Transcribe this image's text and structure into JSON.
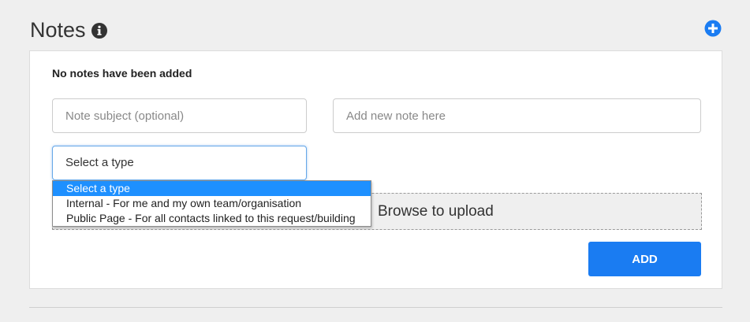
{
  "header": {
    "title": "Notes",
    "info_icon": "info-circle-icon",
    "add_icon": "plus-circle-icon"
  },
  "panel": {
    "empty_message": "No notes have been added",
    "subject_placeholder": "Note subject (optional)",
    "note_placeholder": "Add new note here",
    "type_select": {
      "selected_label": "Select a type",
      "options": [
        "Select a type",
        "Internal - For me and my own team/organisation",
        "Public Page - For all contacts linked to this request/building"
      ]
    },
    "upload_text": "Browse to upload",
    "add_button": "ADD"
  },
  "colors": {
    "accent": "#1a7cf2",
    "option_highlight": "#1e90ff",
    "background": "#efefef"
  }
}
